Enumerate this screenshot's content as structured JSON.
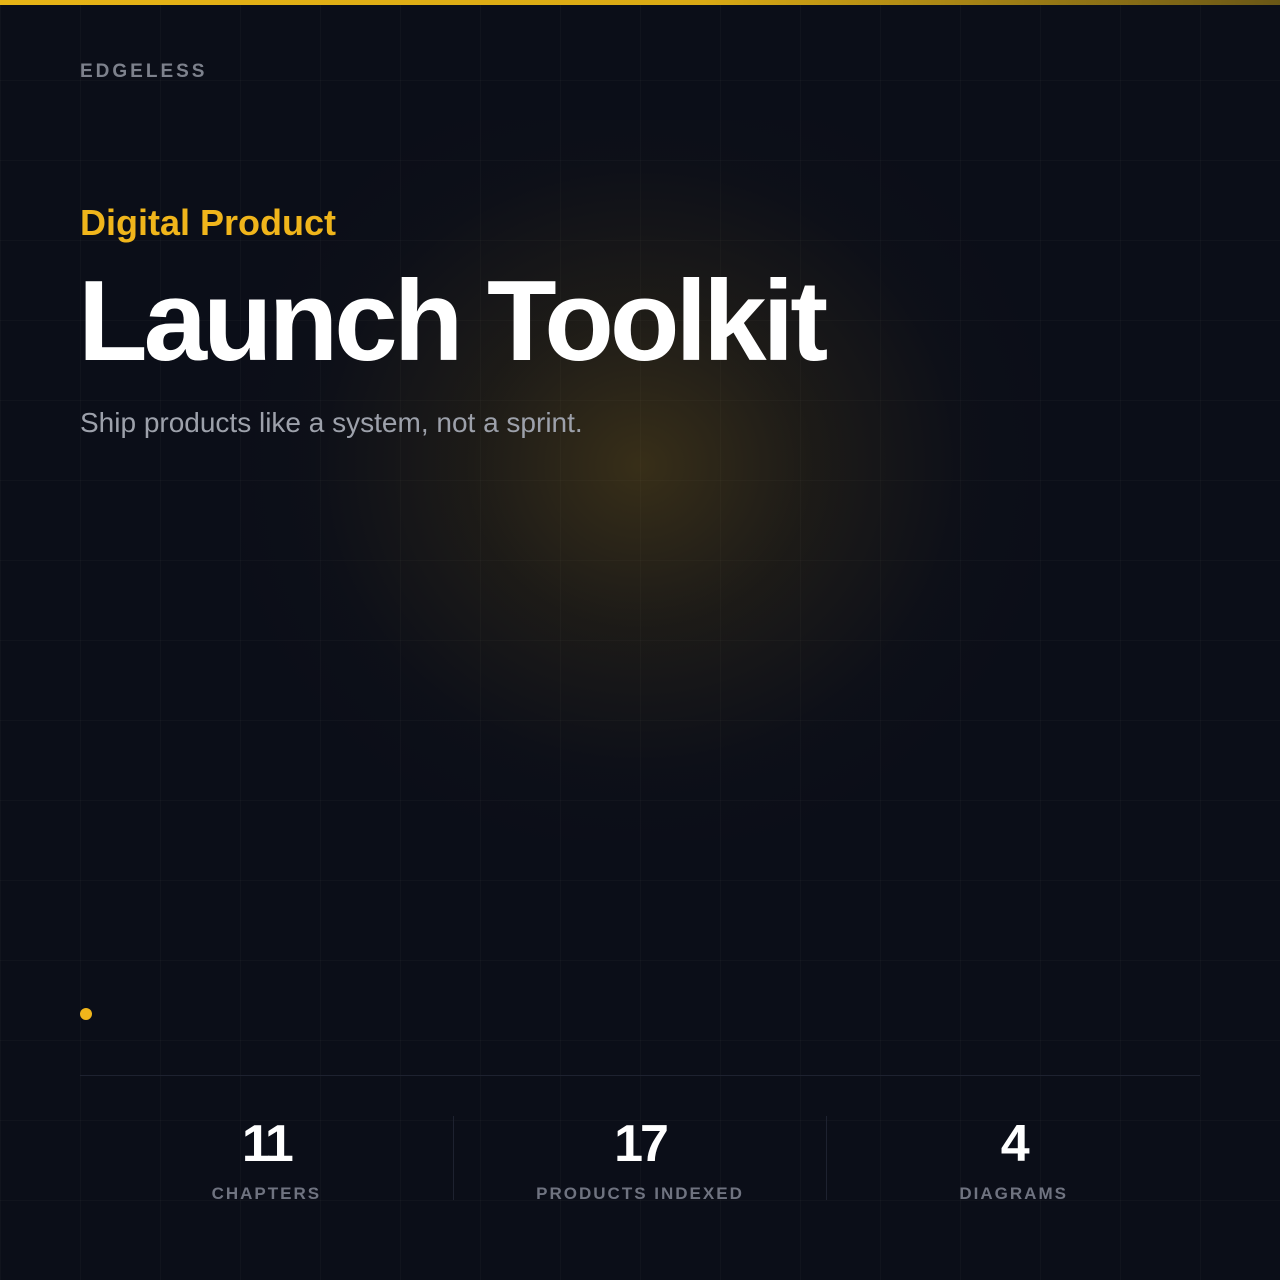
{
  "brand": "EDGELESS",
  "hero": {
    "eyebrow": "Digital Product",
    "title": "Launch Toolkit",
    "tagline": "Ship products like a system, not a sprint."
  },
  "stats": [
    {
      "value": "11",
      "label": "CHAPTERS"
    },
    {
      "value": "17",
      "label": "PRODUCTS INDEXED"
    },
    {
      "value": "4",
      "label": "DIAGRAMS"
    }
  ],
  "colors": {
    "accent": "#f0b51b",
    "background": "#0b0e18",
    "title": "#ffffff",
    "muted": "#7d818c"
  }
}
